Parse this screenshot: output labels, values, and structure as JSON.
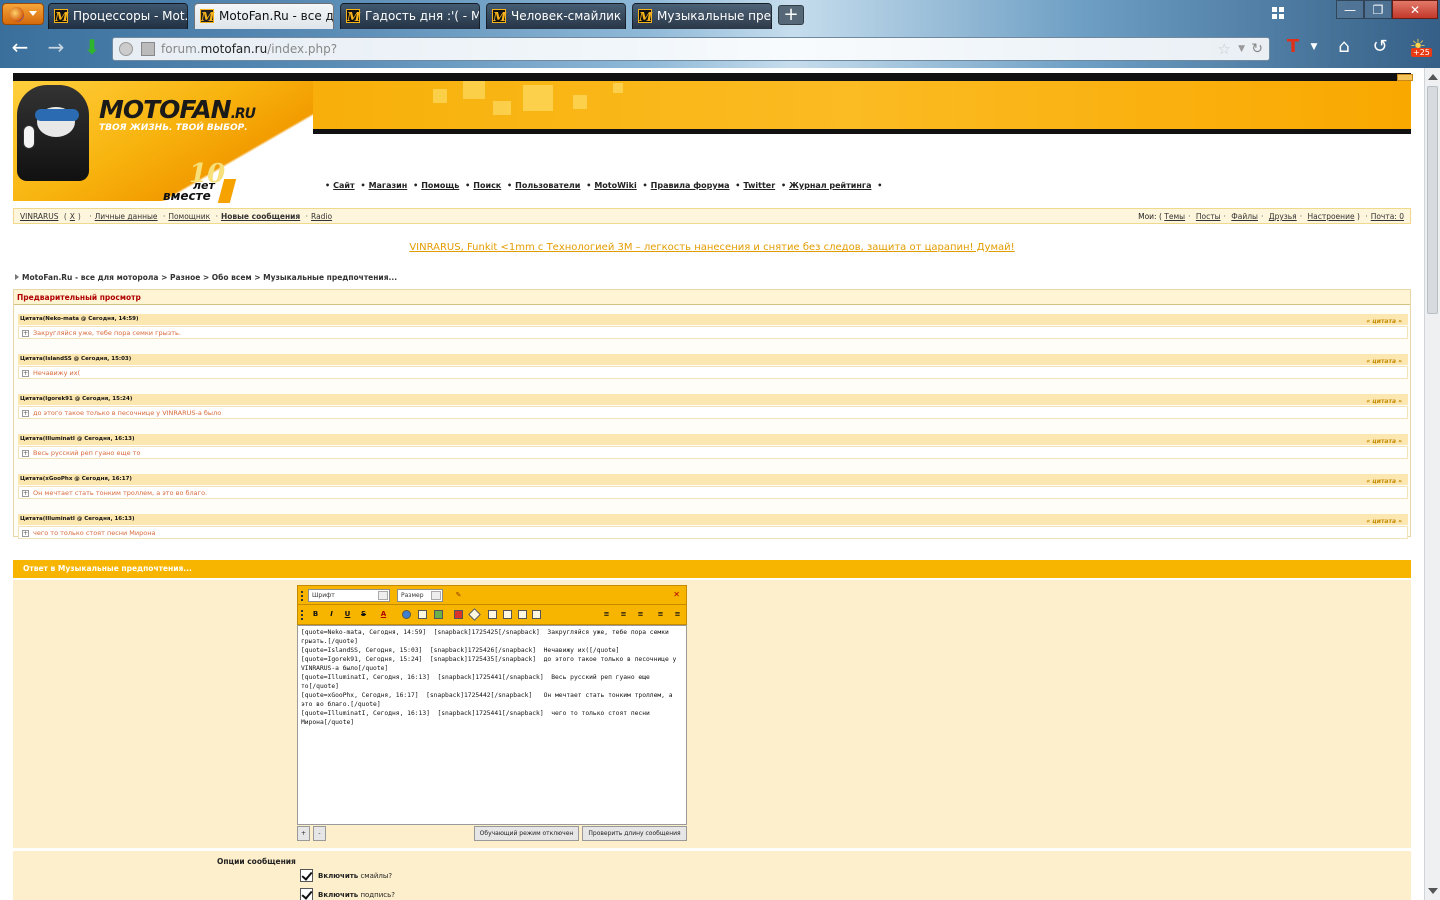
{
  "browser": {
    "tabs": [
      {
        "label": "Процессоры - Mot...",
        "active": false
      },
      {
        "label": "MotoFan.Ru - все дл...",
        "active": true
      },
      {
        "label": "Гадость дня :'( - Mot...",
        "active": false
      },
      {
        "label": "Человек-смайлик =...",
        "active": false
      },
      {
        "label": "Музыкальные пред...",
        "active": false
      }
    ],
    "new_tab": "+",
    "url_prefix": "forum.",
    "url_host": "motofan.ru",
    "url_path": "/index.php?",
    "notification_badge": "+25"
  },
  "site": {
    "logo_name": "MOTOFAN",
    "logo_tld": ".RU",
    "slogan": "ТВОЯ ЖИЗНЬ. ТВОЙ ВЫБОР.",
    "anniversary_number": "10",
    "anniversary_let": "лет",
    "anniversary_vmeste": "вместе",
    "nav": [
      "Сайт",
      "Магазин",
      "Помощь",
      "Поиск",
      "Пользователи",
      "MotoWiki",
      "Правила форума",
      "Twitter",
      "Журнал рейтинга"
    ]
  },
  "userbar": {
    "username": "VINRARUS",
    "logout": "X",
    "personal": "Личные данные",
    "assistant": "Помощник",
    "new_messages": "Новые сообщения",
    "radio": "Radio",
    "mine_label": "Мои: (",
    "mine_items": [
      "Темы",
      "Посты",
      "Файлы",
      "Друзья",
      "Настроение"
    ],
    "mine_close": ")",
    "mail": "Почта: 0"
  },
  "ad_link": "VINRARUS, Funkit <1mm с Технологией 3M – легкость нанесения и снятие без следов, защита от царапин! Думай!",
  "breadcrumb": "MotoFan.Ru - все для моторола > Разное > Обо всем > Музыкальные предпочтения...",
  "preview": {
    "title": "Предварительный просмотр",
    "quote_button": "« цитата »",
    "quotes": [
      {
        "head": "Цитата(Neko-mata @ Сегодня, 14:59)",
        "body": "Закругляйся уже, тебе пора семки грызть."
      },
      {
        "head": "Цитата(IslandSS @ Сегодня, 15:03)",
        "body": "Нечавижу их("
      },
      {
        "head": "Цитата(Igorek91 @ Сегодня, 15:24)",
        "body": "до этого такое только в песочнице у VINRARUS-а было"
      },
      {
        "head": "Цитата(IlluminatI @ Сегодня, 16:13)",
        "body": "Весь русский реп гуано еще то"
      },
      {
        "head": "Цитата(xGooPhx @ Сегодня, 16:17)",
        "body": "Он мечтает стать тонким троллем, а это во благо."
      },
      {
        "head": "Цитата(IlluminatI @ Сегодня, 16:13)",
        "body": "чего то только стоят песни Мирона"
      }
    ]
  },
  "reply": {
    "title": "Ответ в Музыкальные предпочтения...",
    "font_select": "Шрифт",
    "size_select": "Размер",
    "bold": "B",
    "italic": "I",
    "underline": "U",
    "strike": "S",
    "text": "[quote=Neko-mata, Сегодня, 14:59]  [snapback]1725425[/snapback]  Закругляйся уже, тебе пора семки грызть.[/quote]\n[quote=IslandSS, Сегодня, 15:03]  [snapback]1725426[/snapback]  Нечавижу их([/quote]\n[quote=Igorek91, Сегодня, 15:24]  [snapback]1725435[/snapback]  до этого такое только в песочнице у VINRARUS-а было[/quote]\n[quote=IlluminatI, Сегодня, 16:13]  [snapback]1725441[/snapback]  Весь русский реп гуано еще то[/quote]\n[quote=xGooPhx, Сегодня, 16:17]  [snapback]1725442[/snapback]   Он мечтает стать тонким троллем, а это во благо.[/quote]\n[quote=IlluminatI, Сегодня, 16:13]  [snapback]1725441[/snapback]  чего то только стоят песни Мирона[/quote]",
    "plus": "+",
    "minus": "-",
    "tutorial_mode": "Обучающий режим отключен",
    "check_length": "Проверить длину сообщения"
  },
  "options": {
    "title": "Опции сообщения",
    "smilies_bold": "Включить",
    "smilies_rest": " смайлы?",
    "signature_bold": "Включить",
    "signature_rest": " подпись?"
  }
}
